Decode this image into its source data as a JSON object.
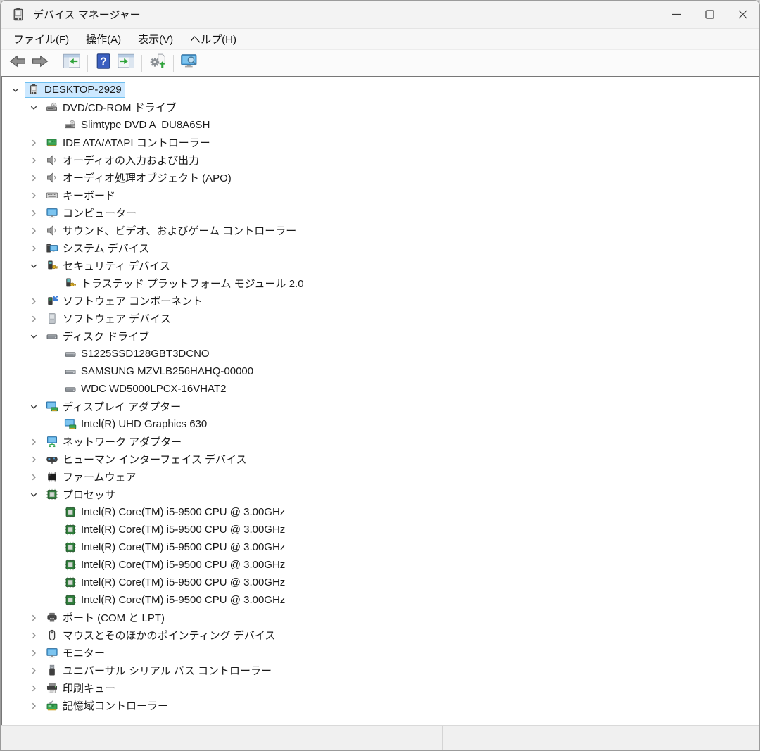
{
  "window": {
    "title": "デバイス マネージャー",
    "app_icon": "device-manager-icon",
    "controls": [
      {
        "name": "minimize",
        "icon": "minimize-icon"
      },
      {
        "name": "maximize",
        "icon": "maximize-icon"
      },
      {
        "name": "close",
        "icon": "close-icon"
      }
    ]
  },
  "menu_bar": {
    "items": [
      {
        "label": "ファイル(F)"
      },
      {
        "label": "操作(A)"
      },
      {
        "label": "表示(V)"
      },
      {
        "label": "ヘルプ(H)"
      }
    ]
  },
  "toolbar": {
    "buttons": [
      {
        "name": "back",
        "icon": "arrow-left-icon"
      },
      {
        "name": "forward",
        "icon": "arrow-right-icon"
      },
      {
        "name": "separator"
      },
      {
        "name": "show-console-tree",
        "icon": "panel-arrow-left-icon"
      },
      {
        "name": "separator"
      },
      {
        "name": "help",
        "icon": "help-icon"
      },
      {
        "name": "show-action-pane",
        "icon": "panel-arrow-right-icon"
      },
      {
        "name": "separator"
      },
      {
        "name": "update-driver",
        "icon": "gear-update-icon"
      },
      {
        "name": "separator"
      },
      {
        "name": "scan-hardware-changes",
        "icon": "monitor-scan-icon"
      }
    ]
  },
  "tree": {
    "rows": [
      {
        "level": 0,
        "state": "expanded",
        "icon": "computer-icon",
        "label": "DESKTOP-2929",
        "selected": true
      },
      {
        "level": 1,
        "state": "expanded",
        "icon": "cd-drive-icon",
        "label": "DVD/CD-ROM ドライブ"
      },
      {
        "level": 2,
        "state": "leaf",
        "icon": "cd-drive-icon",
        "label": "Slimtype DVD A  DU8A6SH"
      },
      {
        "level": 1,
        "state": "collapsed",
        "icon": "ide-controller-icon",
        "label": "IDE ATA/ATAPI コントローラー"
      },
      {
        "level": 1,
        "state": "collapsed",
        "icon": "audio-speaker-icon",
        "label": "オーディオの入力および出力"
      },
      {
        "level": 1,
        "state": "collapsed",
        "icon": "audio-speaker-icon",
        "label": "オーディオ処理オブジェクト (APO)"
      },
      {
        "level": 1,
        "state": "collapsed",
        "icon": "keyboard-icon",
        "label": "キーボード"
      },
      {
        "level": 1,
        "state": "collapsed",
        "icon": "monitor-icon",
        "label": "コンピューター"
      },
      {
        "level": 1,
        "state": "collapsed",
        "icon": "audio-speaker-icon",
        "label": "サウンド、ビデオ、およびゲーム コントローラー"
      },
      {
        "level": 1,
        "state": "collapsed",
        "icon": "system-device-icon",
        "label": "システム デバイス"
      },
      {
        "level": 1,
        "state": "expanded",
        "icon": "security-device-icon",
        "label": "セキュリティ デバイス"
      },
      {
        "level": 2,
        "state": "leaf",
        "icon": "security-device-icon",
        "label": "トラステッド プラットフォーム モジュール 2.0"
      },
      {
        "level": 1,
        "state": "collapsed",
        "icon": "software-component-icon",
        "label": "ソフトウェア コンポーネント"
      },
      {
        "level": 1,
        "state": "collapsed",
        "icon": "software-device-icon",
        "label": "ソフトウェア デバイス"
      },
      {
        "level": 1,
        "state": "expanded",
        "icon": "disk-drive-icon",
        "label": "ディスク ドライブ"
      },
      {
        "level": 2,
        "state": "leaf",
        "icon": "disk-drive-icon",
        "label": "S1225SSD128GBT3DCNO"
      },
      {
        "level": 2,
        "state": "leaf",
        "icon": "disk-drive-icon",
        "label": "SAMSUNG MZVLB256HAHQ-00000"
      },
      {
        "level": 2,
        "state": "leaf",
        "icon": "disk-drive-icon",
        "label": "WDC WD5000LPCX-16VHAT2"
      },
      {
        "level": 1,
        "state": "expanded",
        "icon": "display-adapter-icon",
        "label": "ディスプレイ アダプター"
      },
      {
        "level": 2,
        "state": "leaf",
        "icon": "display-adapter-icon",
        "label": "Intel(R) UHD Graphics 630"
      },
      {
        "level": 1,
        "state": "collapsed",
        "icon": "network-adapter-icon",
        "label": "ネットワーク アダプター"
      },
      {
        "level": 1,
        "state": "collapsed",
        "icon": "hid-gamepad-icon",
        "label": "ヒューマン インターフェイス デバイス"
      },
      {
        "level": 1,
        "state": "collapsed",
        "icon": "firmware-chip-icon",
        "label": "ファームウェア"
      },
      {
        "level": 1,
        "state": "expanded",
        "icon": "processor-icon",
        "label": "プロセッサ"
      },
      {
        "level": 2,
        "state": "leaf",
        "icon": "processor-icon",
        "label": "Intel(R) Core(TM) i5-9500 CPU @ 3.00GHz"
      },
      {
        "level": 2,
        "state": "leaf",
        "icon": "processor-icon",
        "label": "Intel(R) Core(TM) i5-9500 CPU @ 3.00GHz"
      },
      {
        "level": 2,
        "state": "leaf",
        "icon": "processor-icon",
        "label": "Intel(R) Core(TM) i5-9500 CPU @ 3.00GHz"
      },
      {
        "level": 2,
        "state": "leaf",
        "icon": "processor-icon",
        "label": "Intel(R) Core(TM) i5-9500 CPU @ 3.00GHz"
      },
      {
        "level": 2,
        "state": "leaf",
        "icon": "processor-icon",
        "label": "Intel(R) Core(TM) i5-9500 CPU @ 3.00GHz"
      },
      {
        "level": 2,
        "state": "leaf",
        "icon": "processor-icon",
        "label": "Intel(R) Core(TM) i5-9500 CPU @ 3.00GHz"
      },
      {
        "level": 1,
        "state": "collapsed",
        "icon": "serial-port-icon",
        "label": "ポート (COM と LPT)"
      },
      {
        "level": 1,
        "state": "collapsed",
        "icon": "mouse-icon",
        "label": "マウスとそのほかのポインティング デバイス"
      },
      {
        "level": 1,
        "state": "collapsed",
        "icon": "monitor-icon",
        "label": "モニター"
      },
      {
        "level": 1,
        "state": "collapsed",
        "icon": "usb-icon",
        "label": "ユニバーサル シリアル バス コントローラー"
      },
      {
        "level": 1,
        "state": "collapsed",
        "icon": "printer-icon",
        "label": "印刷キュー"
      },
      {
        "level": 1,
        "state": "collapsed",
        "icon": "storage-controller-icon",
        "label": "記憶域コントローラー"
      }
    ]
  },
  "status_bar": {
    "sections": [
      "",
      "",
      ""
    ]
  },
  "colors": {
    "titlebar_bg": "#f3f3f3",
    "tree_bg": "#ffffff",
    "selection_bg": "#cce8ff",
    "selection_border": "#70c0f0",
    "status_bg": "#f0f0f0",
    "tree_border": "#777777"
  }
}
